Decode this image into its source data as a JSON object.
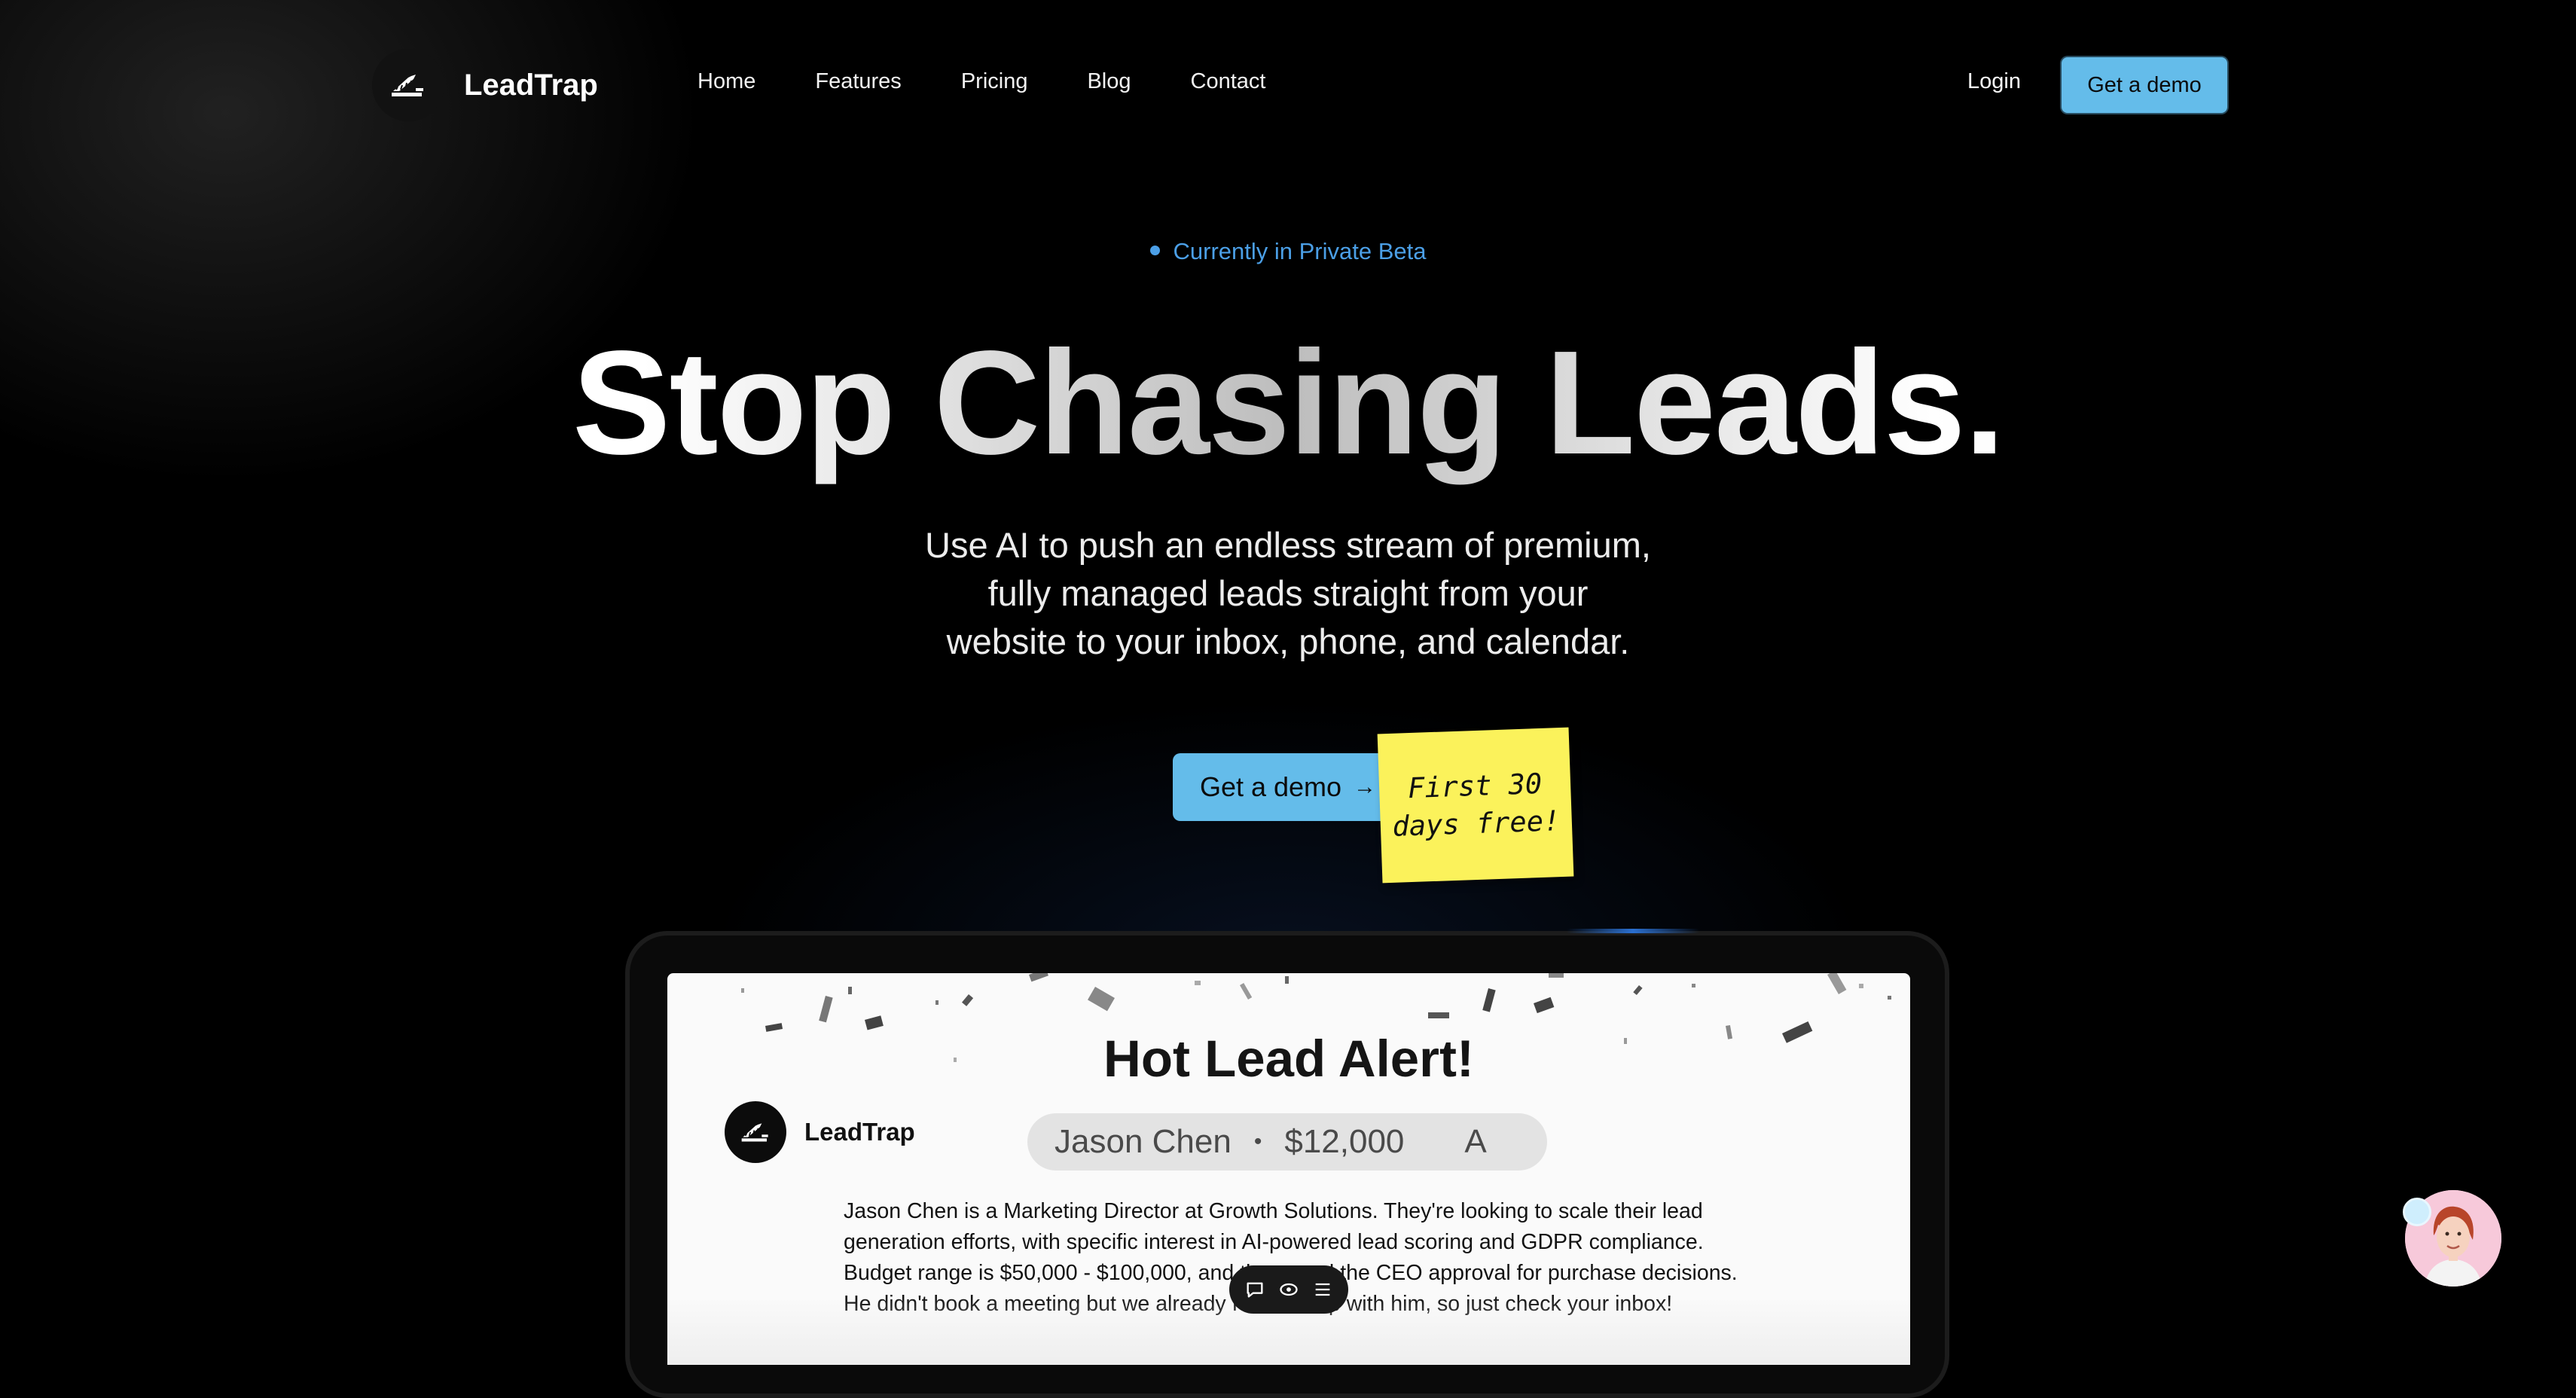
{
  "nav": {
    "brand": "LeadTrap",
    "links": [
      "Home",
      "Features",
      "Pricing",
      "Blog",
      "Contact"
    ],
    "login": "Login",
    "cta": "Get a demo"
  },
  "hero": {
    "badge": "Currently in Private Beta",
    "headline": "Stop Chasing Leads.",
    "subheadline_lines": [
      "Use AI to push an endless stream of premium,",
      "fully managed leads straight from your",
      "website to your inbox, phone, and calendar."
    ],
    "cta": "Get a demo",
    "cta_arrow": "→",
    "sticky_note_lines": [
      "First 30",
      "days free!"
    ]
  },
  "preview": {
    "alert_title": "Hot Lead Alert!",
    "brand": "LeadTrap",
    "lead": {
      "name": "Jason Chen",
      "separator": "•",
      "value": "$12,000",
      "grade": "A"
    },
    "description_lines": [
      "Jason Chen is a Marketing Director at Growth Solutions. They're looking to scale their lead",
      "generation efforts, with specific interest in AI-powered lead scoring and GDPR compliance.",
      "Budget range is $50,000 - $100,000, and they need the CEO approval for purchase decisions.",
      "He didn't book a meeting but we already followed up with him, so just check your inbox!"
    ],
    "toolbar_icons": [
      "comment-icon",
      "eye-icon",
      "menu-icon"
    ]
  },
  "colors": {
    "accent": "#64bcea",
    "badge_blue": "#4b9fe6",
    "sticky_yellow": "#fbf25b",
    "background": "#000000"
  },
  "chat_widget": {
    "icon": "support-avatar"
  }
}
